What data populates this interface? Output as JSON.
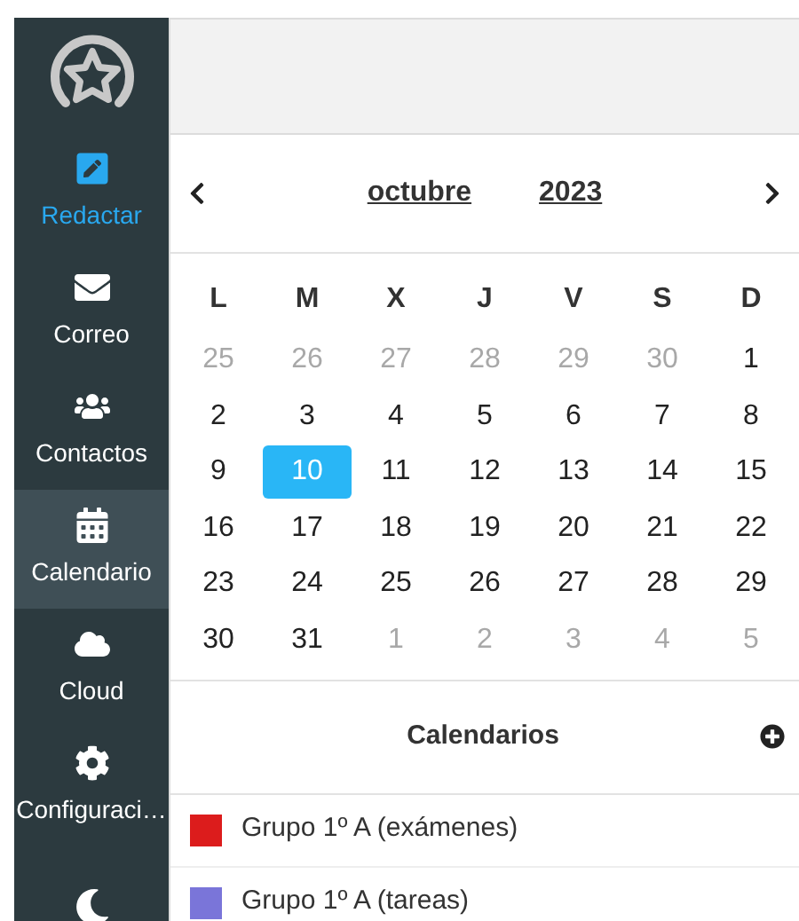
{
  "sidebar": {
    "items": [
      {
        "label": "Redactar",
        "kind": "compose",
        "selected": false,
        "highlight": true
      },
      {
        "label": "Correo",
        "kind": "mail",
        "selected": false,
        "highlight": false
      },
      {
        "label": "Contactos",
        "kind": "users",
        "selected": false,
        "highlight": false
      },
      {
        "label": "Calendario",
        "kind": "calendar",
        "selected": true,
        "highlight": false
      },
      {
        "label": "Cloud",
        "kind": "cloud",
        "selected": false,
        "highlight": false
      },
      {
        "label": "Configuraci…",
        "kind": "gear",
        "selected": false,
        "highlight": false
      },
      {
        "kind": "moon",
        "selected": false
      }
    ]
  },
  "calendar": {
    "month": "octubre",
    "year": "2023",
    "weekdays": [
      "L",
      "M",
      "X",
      "J",
      "V",
      "S",
      "D"
    ],
    "weeks": [
      [
        {
          "d": "25",
          "muted": true,
          "selected": false
        },
        {
          "d": "26",
          "muted": true,
          "selected": false
        },
        {
          "d": "27",
          "muted": true,
          "selected": false
        },
        {
          "d": "28",
          "muted": true,
          "selected": false
        },
        {
          "d": "29",
          "muted": true,
          "selected": false
        },
        {
          "d": "30",
          "muted": true,
          "selected": false
        },
        {
          "d": "1",
          "muted": false,
          "selected": false
        }
      ],
      [
        {
          "d": "2",
          "muted": false,
          "selected": false
        },
        {
          "d": "3",
          "muted": false,
          "selected": false
        },
        {
          "d": "4",
          "muted": false,
          "selected": false
        },
        {
          "d": "5",
          "muted": false,
          "selected": false
        },
        {
          "d": "6",
          "muted": false,
          "selected": false
        },
        {
          "d": "7",
          "muted": false,
          "selected": false
        },
        {
          "d": "8",
          "muted": false,
          "selected": false
        }
      ],
      [
        {
          "d": "9",
          "muted": false,
          "selected": false
        },
        {
          "d": "10",
          "muted": false,
          "selected": true
        },
        {
          "d": "11",
          "muted": false,
          "selected": false
        },
        {
          "d": "12",
          "muted": false,
          "selected": false
        },
        {
          "d": "13",
          "muted": false,
          "selected": false
        },
        {
          "d": "14",
          "muted": false,
          "selected": false
        },
        {
          "d": "15",
          "muted": false,
          "selected": false
        }
      ],
      [
        {
          "d": "16",
          "muted": false,
          "selected": false
        },
        {
          "d": "17",
          "muted": false,
          "selected": false
        },
        {
          "d": "18",
          "muted": false,
          "selected": false
        },
        {
          "d": "19",
          "muted": false,
          "selected": false
        },
        {
          "d": "20",
          "muted": false,
          "selected": false
        },
        {
          "d": "21",
          "muted": false,
          "selected": false
        },
        {
          "d": "22",
          "muted": false,
          "selected": false
        }
      ],
      [
        {
          "d": "23",
          "muted": false,
          "selected": false
        },
        {
          "d": "24",
          "muted": false,
          "selected": false
        },
        {
          "d": "25",
          "muted": false,
          "selected": false
        },
        {
          "d": "26",
          "muted": false,
          "selected": false
        },
        {
          "d": "27",
          "muted": false,
          "selected": false
        },
        {
          "d": "28",
          "muted": false,
          "selected": false
        },
        {
          "d": "29",
          "muted": false,
          "selected": false
        }
      ],
      [
        {
          "d": "30",
          "muted": false,
          "selected": false
        },
        {
          "d": "31",
          "muted": false,
          "selected": false
        },
        {
          "d": "1",
          "muted": true,
          "selected": false
        },
        {
          "d": "2",
          "muted": true,
          "selected": false
        },
        {
          "d": "3",
          "muted": true,
          "selected": false
        },
        {
          "d": "4",
          "muted": true,
          "selected": false
        },
        {
          "d": "5",
          "muted": true,
          "selected": false
        }
      ]
    ]
  },
  "calendars": {
    "title": "Calendarios",
    "items": [
      {
        "name": "Grupo 1º A (exámenes)",
        "color": "#dc1c1c"
      },
      {
        "name": "Grupo 1º A (tareas)",
        "color": "#7a75d9"
      }
    ]
  }
}
